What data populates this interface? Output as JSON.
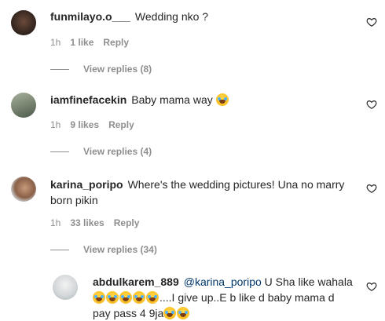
{
  "comments": [
    {
      "username": "funmilayo.o___",
      "text": "Wedding nko ?",
      "time": "1h",
      "likes": "1 like",
      "reply": "Reply",
      "view_replies": "View replies (8)"
    },
    {
      "username": "iamfinefacekin",
      "text": "Baby mama way",
      "time": "1h",
      "likes": "9 likes",
      "reply": "Reply",
      "view_replies": "View replies (4)"
    },
    {
      "username": "karina_poripo",
      "text_line1": "Where's the wedding pictures! Una no marry",
      "text_line2": "born pikin",
      "time": "1h",
      "likes": "33 likes",
      "reply": "Reply",
      "view_replies": "View replies (34)"
    },
    {
      "username": "abdulkarem_889",
      "mention": "@karina_poripo",
      "text_part1": "U Sha like wahala",
      "text_part2": "....I give up..E b like d baby mama d",
      "text_part3": "pay pass 4 9ja"
    }
  ],
  "icons": {
    "heart": "heart-outline-icon",
    "emoji": "face-with-tears-of-joy-emoji"
  },
  "colors": {
    "text": "#262626",
    "muted": "#8e8e8e",
    "mention": "#00376b"
  }
}
